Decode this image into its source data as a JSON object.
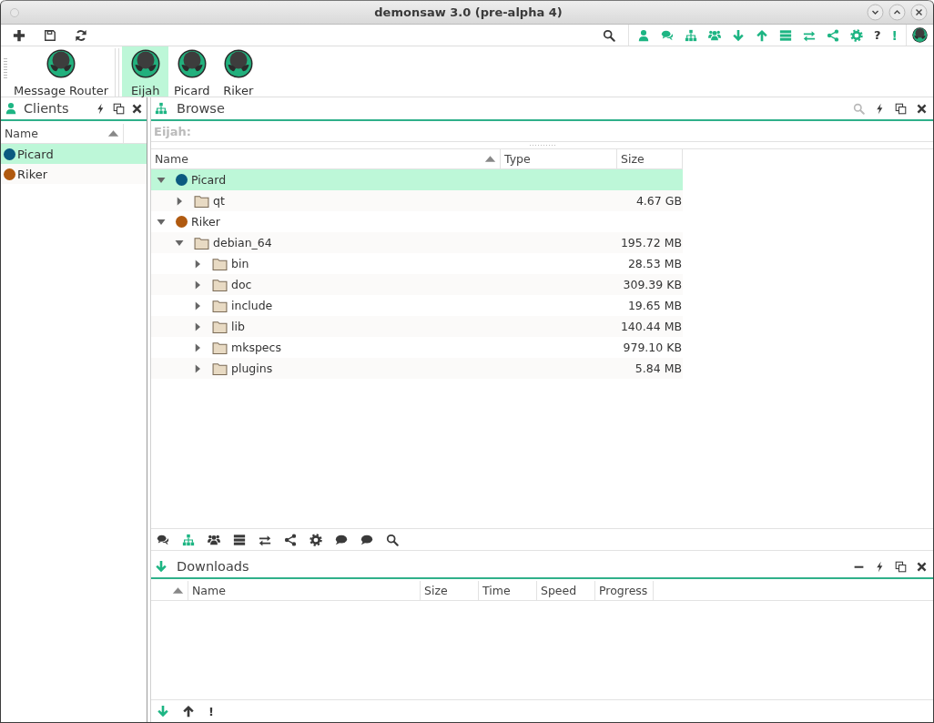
{
  "window": {
    "title": "demonsaw 3.0 (pre-alpha 4)"
  },
  "toolbar": {
    "help": "?",
    "alert": "!"
  },
  "routers": [
    {
      "label": "Message Router",
      "selected": false
    },
    {
      "label": "Eijah",
      "selected": true
    },
    {
      "label": "Picard",
      "selected": false
    },
    {
      "label": "Riker",
      "selected": false
    }
  ],
  "clients": {
    "title": "Clients",
    "columns": [
      {
        "label": "Name",
        "sorted": true
      }
    ],
    "rows": [
      {
        "name": "Picard",
        "color": "#0b5a80",
        "selected": true
      },
      {
        "name": "Riker",
        "color": "#b05a10",
        "selected": false
      }
    ]
  },
  "browse": {
    "title": "Browse",
    "filter": {
      "placeholder": "Eijah:"
    },
    "columns": [
      {
        "label": "Name",
        "sorted": true
      },
      {
        "label": "Type",
        "sorted": false
      },
      {
        "label": "Size",
        "sorted": false
      }
    ],
    "tree": [
      {
        "kind": "client",
        "name": "Picard",
        "color": "#0b5a80",
        "expanded": true,
        "selected": true,
        "children": [
          {
            "kind": "folder",
            "name": "qt",
            "size": "4.67 GB",
            "expanded": false,
            "selected": false
          }
        ]
      },
      {
        "kind": "client",
        "name": "Riker",
        "color": "#b05a10",
        "expanded": true,
        "selected": false,
        "children": [
          {
            "kind": "folder",
            "name": "debian_64",
            "size": "195.72 MB",
            "expanded": true,
            "selected": false,
            "children": [
              {
                "kind": "folder",
                "name": "bin",
                "size": "28.53 MB",
                "expanded": false,
                "selected": false
              },
              {
                "kind": "folder",
                "name": "doc",
                "size": "309.39 KB",
                "expanded": false,
                "selected": false
              },
              {
                "kind": "folder",
                "name": "include",
                "size": "19.65 MB",
                "expanded": false,
                "selected": false
              },
              {
                "kind": "folder",
                "name": "lib",
                "size": "140.44 MB",
                "expanded": false,
                "selected": false
              },
              {
                "kind": "folder",
                "name": "mkspecs",
                "size": "979.10 KB",
                "expanded": false,
                "selected": false
              },
              {
                "kind": "folder",
                "name": "plugins",
                "size": "5.84 MB",
                "expanded": false,
                "selected": false
              }
            ]
          }
        ]
      }
    ]
  },
  "view_bar": [
    {
      "selected": false
    },
    {
      "selected": true
    },
    {
      "selected": false
    },
    {
      "selected": false
    },
    {
      "selected": false
    },
    {
      "selected": false
    },
    {
      "selected": false
    },
    {
      "selected": false
    },
    {
      "selected": false
    },
    {
      "selected": false
    }
  ],
  "downloads": {
    "title": "Downloads",
    "columns": [
      {
        "sorted": true
      },
      {
        "label": "Name",
        "sorted": false
      },
      {
        "label": "Size",
        "sorted": false
      },
      {
        "label": "Time",
        "sorted": false
      },
      {
        "label": "Speed",
        "sorted": false
      },
      {
        "label": "Progress",
        "sorted": false
      }
    ],
    "footer": {
      "alert": "!"
    }
  }
}
